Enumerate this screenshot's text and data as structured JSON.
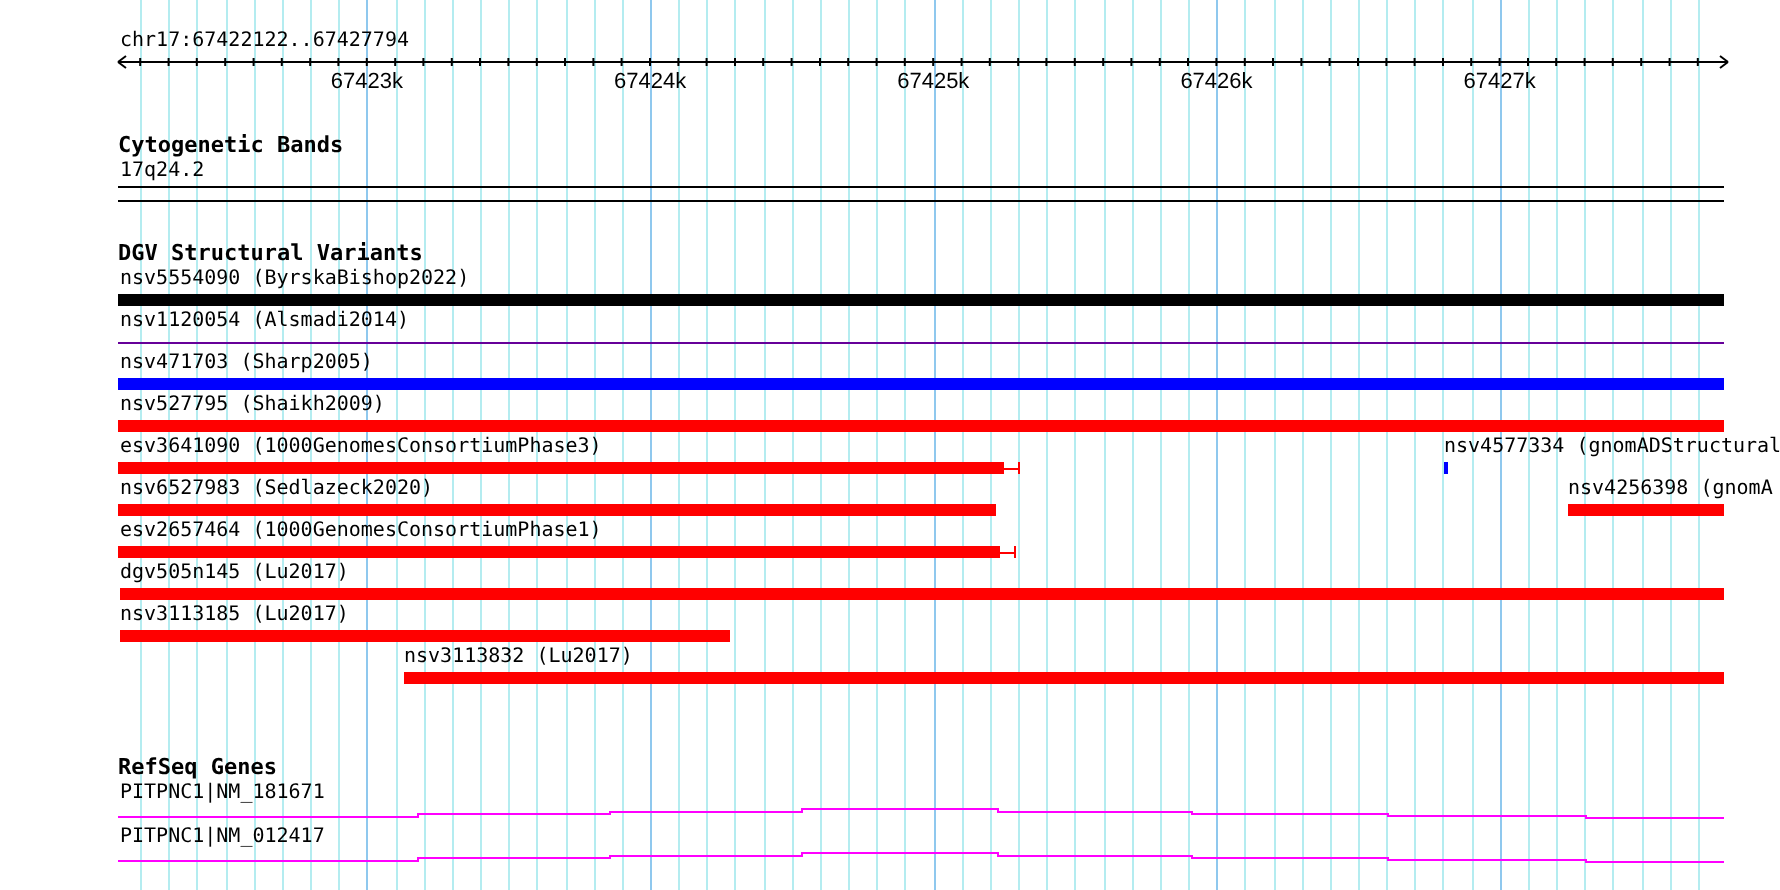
{
  "ruler": {
    "location": "chr17:67422122..67427794",
    "ticks": [
      "67423k",
      "67424k",
      "67425k",
      "67426k",
      "67427k"
    ]
  },
  "tracks": [
    {
      "title": "Cytogenetic Bands",
      "kind": "bands",
      "features": [
        {
          "label": "17q24.2"
        }
      ]
    },
    {
      "title": "DGV Structural Variants",
      "kind": "variants",
      "rows": [
        [
          {
            "label": "nsv5554090 (ByrskaBishop2022)",
            "kind": "bar",
            "color": "#000000"
          }
        ],
        [
          {
            "label": "nsv1120054 (Alsmadi2014)",
            "kind": "line",
            "color": "#660099"
          }
        ],
        [
          {
            "label": "nsv471703 (Sharp2005)",
            "kind": "bar",
            "color": "#0000ff"
          }
        ],
        [
          {
            "label": "nsv527795 (Shaikh2009)",
            "kind": "bar",
            "color": "#ff0000"
          }
        ],
        [
          {
            "label": "esv3641090 (1000GenomesConsortiumPhase3)",
            "kind": "capped",
            "color": "#ff0000"
          },
          {
            "label": "nsv4577334 (gnomADStructural",
            "kind": "tick",
            "color": "#0000ff"
          }
        ],
        [
          {
            "label": "nsv6527983 (Sedlazeck2020)",
            "kind": "bar",
            "color": "#ff0000"
          },
          {
            "label": "nsv4256398 (gnomA",
            "kind": "bar",
            "color": "#ff0000"
          }
        ],
        [
          {
            "label": "esv2657464 (1000GenomesConsortiumPhase1)",
            "kind": "capped",
            "color": "#ff0000"
          }
        ],
        [
          {
            "label": "dgv505n145 (Lu2017)",
            "kind": "bar",
            "color": "#ff0000"
          }
        ],
        [
          {
            "label": "nsv3113185 (Lu2017)",
            "kind": "bar",
            "color": "#ff0000"
          }
        ],
        [
          {
            "label": "nsv3113832 (Lu2017)",
            "kind": "bar",
            "color": "#ff0000"
          }
        ]
      ]
    },
    {
      "title": "RefSeq Genes",
      "kind": "genes",
      "features": [
        {
          "label": "PITPNC1|NM_181671"
        },
        {
          "label": "PITPNC1|NM_012417"
        }
      ]
    }
  ]
}
